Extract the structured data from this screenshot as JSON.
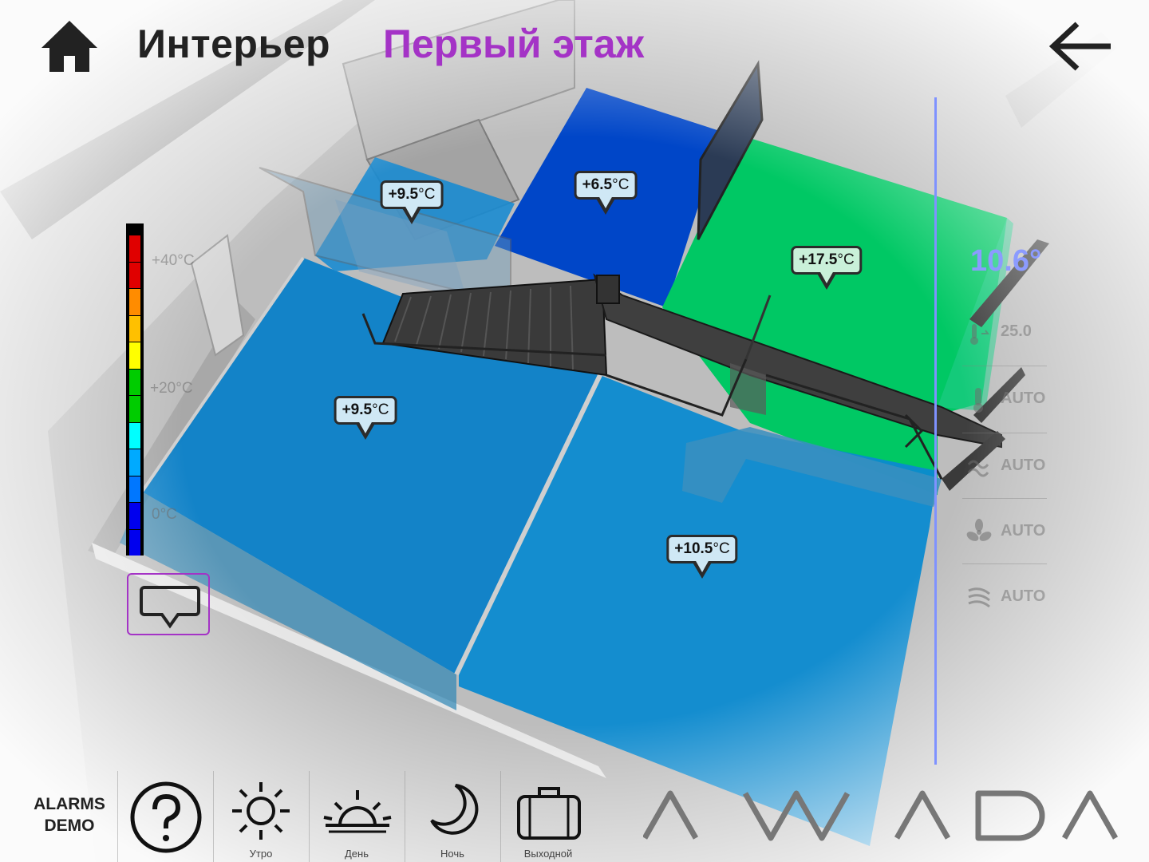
{
  "header": {
    "title": "Интерьер",
    "floor": "Первый этаж"
  },
  "rooms": [
    {
      "temp": "+9.5",
      "unit": "°C",
      "status": "blue"
    },
    {
      "temp": "+6.5",
      "unit": "°C",
      "status": "dark-blue"
    },
    {
      "temp": "+17.5",
      "unit": "°C",
      "status": "green"
    },
    {
      "temp": "+9.5",
      "unit": "°C",
      "status": "blue"
    },
    {
      "temp": "+10.5",
      "unit": "°C",
      "status": "blue"
    }
  ],
  "scale": {
    "labels": [
      "+40°C",
      "+20°C",
      "0°C"
    ],
    "colors": [
      "#e00000",
      "#e00000",
      "#ff8c00",
      "#ffc000",
      "#ffff00",
      "#00cc00",
      "#00cc00",
      "#00ffff",
      "#00aaff",
      "#0077ff",
      "#0000ee",
      "#0000ee"
    ]
  },
  "control_panel": {
    "setpoint": "10.6°",
    "rows": [
      {
        "icon": "thermometer-arrow-icon",
        "value": "25.0"
      },
      {
        "icon": "thermometer-icon",
        "value": "AUTO"
      },
      {
        "icon": "wave-icon",
        "value": "AUTO"
      },
      {
        "icon": "fan-icon",
        "value": "AUTO"
      },
      {
        "icon": "heat-waves-icon",
        "value": "AUTO"
      }
    ]
  },
  "toolbar": {
    "alarms_line1": "ALARMS",
    "alarms_line2": "DEMO",
    "buttons": [
      {
        "label": "Утро",
        "icon": "sun-icon"
      },
      {
        "label": "День",
        "icon": "sunrise-icon"
      },
      {
        "label": "Ночь",
        "icon": "moon-icon"
      },
      {
        "label": "Выходной",
        "icon": "suitcase-icon"
      }
    ]
  },
  "brand": "AWADA",
  "colors": {
    "accent": "#a433c6",
    "setpoint": "#8c9bff",
    "room_blue": "#0a7fc8",
    "room_dark_blue": "#0046c8",
    "room_green": "#00c864"
  }
}
